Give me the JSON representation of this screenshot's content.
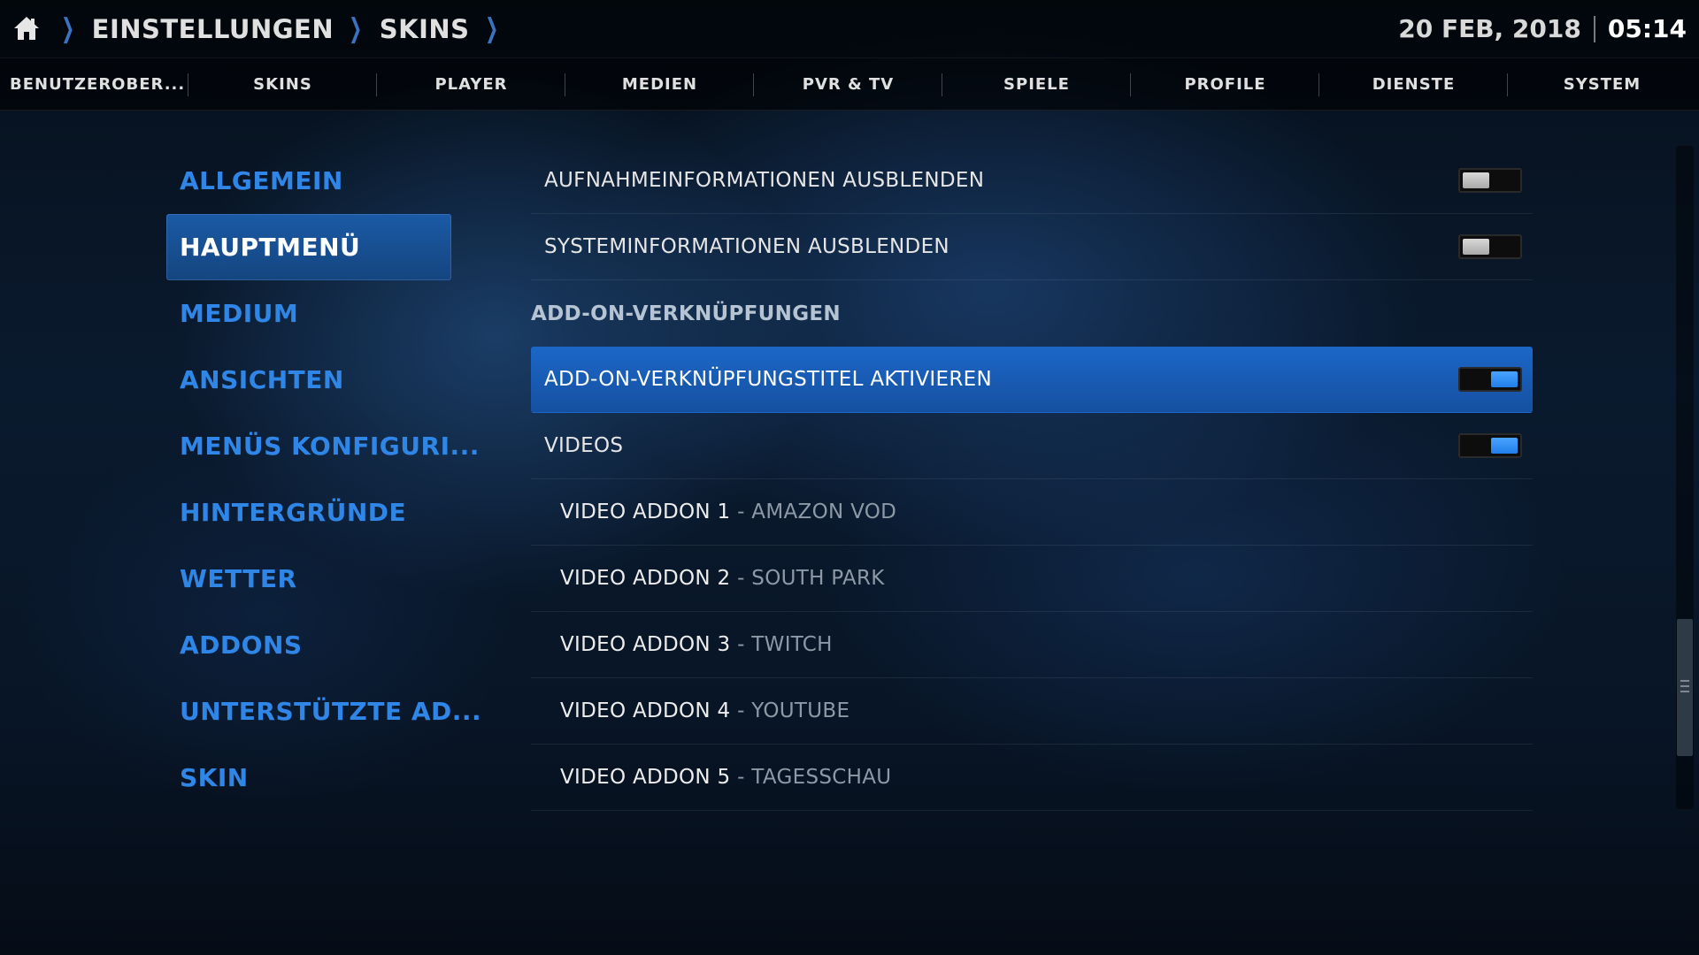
{
  "header": {
    "home_icon": "home-icon",
    "breadcrumb": [
      "EINSTELLUNGEN",
      "SKINS"
    ],
    "date": "20 FEB, 2018",
    "time": "05:14"
  },
  "tabs": [
    {
      "label": "BENUTZEROBER..."
    },
    {
      "label": "SKINS"
    },
    {
      "label": "PLAYER"
    },
    {
      "label": "MEDIEN"
    },
    {
      "label": "PVR & TV"
    },
    {
      "label": "SPIELE"
    },
    {
      "label": "PROFILE"
    },
    {
      "label": "DIENSTE"
    },
    {
      "label": "SYSTEM"
    }
  ],
  "categories": [
    {
      "label": "ALLGEMEIN"
    },
    {
      "label": "HAUPTMENÜ",
      "active": true
    },
    {
      "label": "MEDIUM"
    },
    {
      "label": "ANSICHTEN"
    },
    {
      "label": "MENÜS KONFIGURI..."
    },
    {
      "label": "HINTERGRÜNDE"
    },
    {
      "label": "WETTER"
    },
    {
      "label": "ADDONS"
    },
    {
      "label": "UNTERSTÜTZTE AD..."
    },
    {
      "label": "SKIN"
    }
  ],
  "settings": [
    {
      "label": "AUFNAHMEINFORMATIONEN AUSBLENDEN",
      "toggle": "off"
    },
    {
      "label": "SYSTEMINFORMATIONEN AUSBLENDEN",
      "toggle": "off"
    },
    {
      "label": "ADD-ON-VERKNÜPFUNGEN",
      "section": true
    },
    {
      "label": "ADD-ON-VERKNÜPFUNGSTITEL AKTIVIEREN",
      "toggle": "on",
      "selected": true
    },
    {
      "label": "VIDEOS",
      "toggle": "on"
    },
    {
      "label": "VIDEO ADDON 1",
      "sub": " - AMAZON VOD"
    },
    {
      "label": "VIDEO ADDON 2",
      "sub": " - SOUTH PARK"
    },
    {
      "label": "VIDEO ADDON 3",
      "sub": " - TWITCH"
    },
    {
      "label": "VIDEO ADDON 4",
      "sub": " - YOUTUBE"
    },
    {
      "label": "VIDEO ADDON 5",
      "sub": " - TAGESSCHAU"
    }
  ],
  "colors": {
    "accent": "#2f86e6",
    "selected_bg": "#1c67c8",
    "toggle_on": "#4aa3ff"
  }
}
